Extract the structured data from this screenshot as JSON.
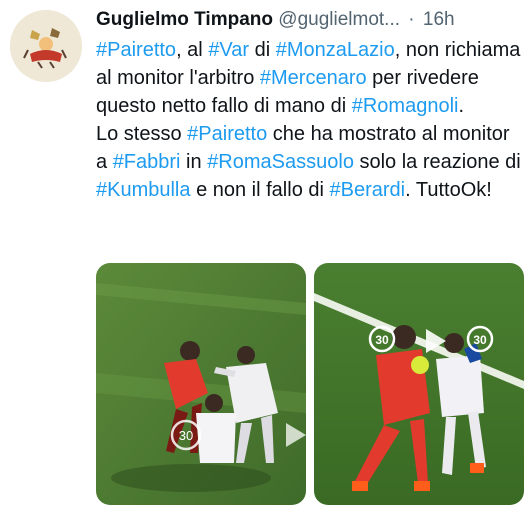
{
  "author": {
    "name": "Guglielmo Timpano",
    "handle": "@guglielmot...",
    "separator": "·",
    "time": "16h"
  },
  "tweet": {
    "line1": [
      {
        "text": "#Pairetto",
        "tag": true
      },
      {
        "text": ", al ",
        "tag": false
      },
      {
        "text": "#Var",
        "tag": true
      },
      {
        "text": " di ",
        "tag": false
      },
      {
        "text": "#MonzaLazio",
        "tag": true
      },
      {
        "text": ", non richiama al monitor l'arbitro ",
        "tag": false
      },
      {
        "text": "#Mercenaro",
        "tag": true
      },
      {
        "text": " per rivedere questo netto fallo di mano di ",
        "tag": false
      },
      {
        "text": "#Romagnoli",
        "tag": true
      },
      {
        "text": ".",
        "tag": false
      }
    ],
    "line2": [
      {
        "text": "Lo stesso ",
        "tag": false
      },
      {
        "text": "#Pairetto",
        "tag": true
      },
      {
        "text": " che ha mostrato al monitor a ",
        "tag": false
      },
      {
        "text": "#Fabbri",
        "tag": true
      },
      {
        "text": " in ",
        "tag": false
      },
      {
        "text": "#RomaSassuolo",
        "tag": true
      },
      {
        "text": " solo la reazione di ",
        "tag": false
      },
      {
        "text": "#Kumbulla",
        "tag": true
      },
      {
        "text": " e non il fallo di ",
        "tag": false
      },
      {
        "text": "#Berardi",
        "tag": true
      },
      {
        "text": ". TuttoOk!",
        "tag": false
      }
    ]
  },
  "media": {
    "image_left": {
      "overlay_number": "30"
    },
    "image_right": {
      "rewind_label": "30",
      "forward_label": "30"
    }
  },
  "colors": {
    "hashtag": "#1d9bf0",
    "text": "#0f1419",
    "secondary": "#536471",
    "pitch": "#4c7a34",
    "monza_red": "#e23a2c"
  },
  "icons": [
    "avatar-cartoon",
    "rewind-30-icon",
    "forward-30-icon",
    "play-icon"
  ]
}
